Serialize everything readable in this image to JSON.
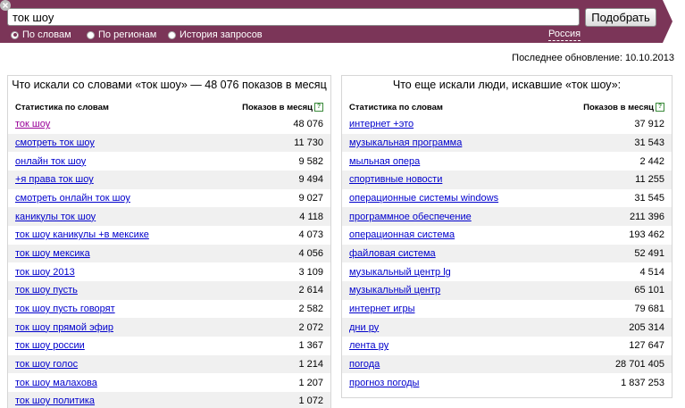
{
  "colors": {
    "bar": "#7b3558",
    "link": "#0000cc",
    "visited": "#990099"
  },
  "search": {
    "value": "ток шоу",
    "submit_label": "Подобрать"
  },
  "modes": [
    {
      "label": "По словам",
      "selected": true
    },
    {
      "label": "По регионам",
      "selected": false
    },
    {
      "label": "История запросов",
      "selected": false
    }
  ],
  "region": "Россия",
  "updated": "Последнее обновление: 10.10.2013",
  "left": {
    "title": "Что искали со словами «ток шоу» — 48 076 показов в месяц",
    "col_phrase": "Статистика по словам",
    "col_count": "Показов в месяц",
    "rows": [
      {
        "phrase": "ток шоу",
        "count": "48 076"
      },
      {
        "phrase": "смотреть ток шоу",
        "count": "11 730"
      },
      {
        "phrase": "онлайн ток шоу",
        "count": "9 582"
      },
      {
        "phrase": "+я права ток шоу",
        "count": "9 494"
      },
      {
        "phrase": "смотреть онлайн ток шоу",
        "count": "9 027"
      },
      {
        "phrase": "каникулы ток шоу",
        "count": "4 118"
      },
      {
        "phrase": "ток шоу каникулы +в мексике",
        "count": "4 073"
      },
      {
        "phrase": "ток шоу мексика",
        "count": "4 056"
      },
      {
        "phrase": "ток шоу 2013",
        "count": "3 109"
      },
      {
        "phrase": "ток шоу пусть",
        "count": "2 614"
      },
      {
        "phrase": "ток шоу пусть говорят",
        "count": "2 582"
      },
      {
        "phrase": "ток шоу прямой эфир",
        "count": "2 072"
      },
      {
        "phrase": "ток шоу россии",
        "count": "1 367"
      },
      {
        "phrase": "ток шоу голос",
        "count": "1 214"
      },
      {
        "phrase": "ток шоу малахова",
        "count": "1 207"
      },
      {
        "phrase": "ток шоу политика",
        "count": "1 072"
      }
    ]
  },
  "right": {
    "title": "Что еще искали люди, искавшие «ток шоу»:",
    "col_phrase": "Статистика по словам",
    "col_count": "Показов в месяц",
    "rows": [
      {
        "phrase": "интернет +это",
        "count": "37 912"
      },
      {
        "phrase": "музыкальная программа",
        "count": "31 543"
      },
      {
        "phrase": "мыльная опера",
        "count": "2 442"
      },
      {
        "phrase": "спортивные новости",
        "count": "11 255"
      },
      {
        "phrase": "операционные системы windows",
        "count": "31 545"
      },
      {
        "phrase": "программное обеспечение",
        "count": "211 396"
      },
      {
        "phrase": "операционная система",
        "count": "193 462"
      },
      {
        "phrase": "файловая система",
        "count": "52 491"
      },
      {
        "phrase": "музыкальный центр lg",
        "count": "4 514"
      },
      {
        "phrase": "музыкальный центр",
        "count": "65 101"
      },
      {
        "phrase": "интернет игры",
        "count": "79 681"
      },
      {
        "phrase": "дни ру",
        "count": "205 314"
      },
      {
        "phrase": "лента ру",
        "count": "127 647"
      },
      {
        "phrase": "погода",
        "count": "28 701 405"
      },
      {
        "phrase": "прогноз погоды",
        "count": "1 837 253"
      }
    ]
  }
}
